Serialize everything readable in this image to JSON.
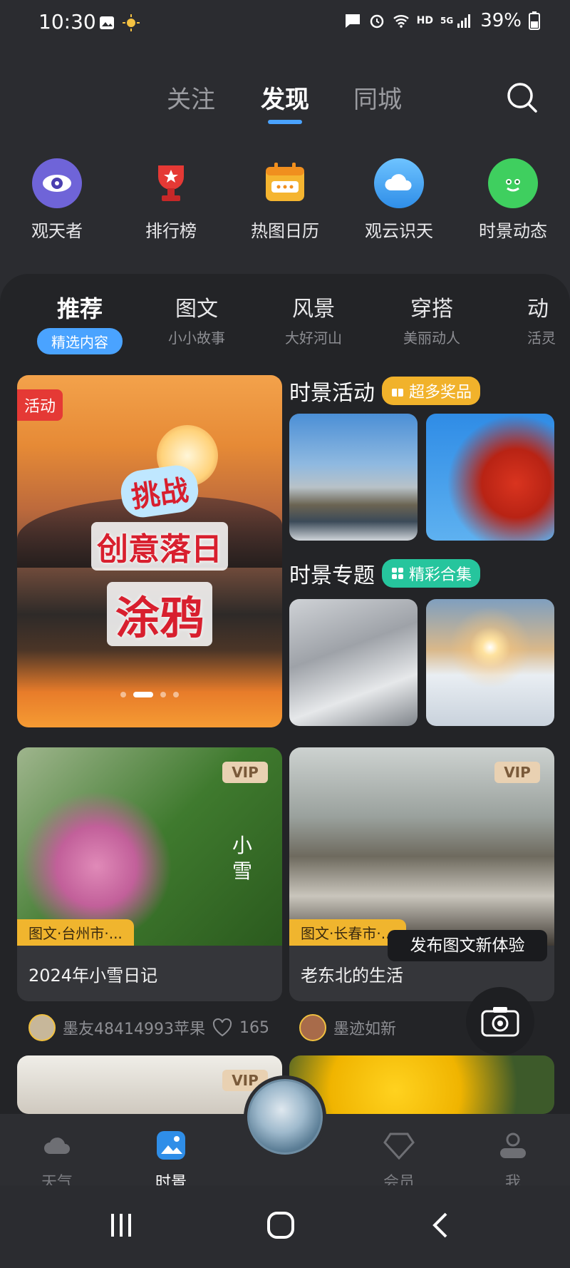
{
  "status_bar": {
    "time": "10:30",
    "network": "5G",
    "hd": "HD",
    "battery": "39%"
  },
  "top_tabs": [
    "关注",
    "发现",
    "同城"
  ],
  "top_tab_active": "发现",
  "quick_icons": [
    {
      "label": "观天者",
      "icon": "eye-icon",
      "color": "#6f64d8"
    },
    {
      "label": "排行榜",
      "icon": "trophy-icon",
      "color": "#e53935"
    },
    {
      "label": "热图日历",
      "icon": "calendar-icon",
      "color": "#f5b530"
    },
    {
      "label": "观云识天",
      "icon": "cloud-icon",
      "color": "#4aa3ff"
    },
    {
      "label": "时景动态",
      "icon": "planet-icon",
      "color": "#3fcf5f"
    }
  ],
  "categories": [
    {
      "title": "推荐",
      "sub": "精选内容"
    },
    {
      "title": "图文",
      "sub": "小小故事"
    },
    {
      "title": "风景",
      "sub": "大好河山"
    },
    {
      "title": "穿搭",
      "sub": "美丽动人"
    },
    {
      "title": "动",
      "sub": "活灵"
    }
  ],
  "banner": {
    "badge": "活动",
    "line1": "挑战",
    "line2": "创意落日",
    "line3": "涂鸦"
  },
  "activity_section": {
    "title": "时景活动",
    "pill": "超多奖品"
  },
  "topic_section": {
    "title": "时景专题",
    "pill": "精彩合集"
  },
  "feed": [
    {
      "vip": "VIP",
      "location": "图文·台州市·...",
      "title": "2024年小雪日记",
      "author": "墨友48414993苹果",
      "likes": "165",
      "overlay_text": "小雪"
    },
    {
      "vip": "VIP",
      "location": "图文·长春市·...",
      "title": "老东北的生活",
      "author": "墨迹如新"
    }
  ],
  "feed_row2": [
    {
      "vip": "VIP"
    }
  ],
  "tooltip": "发布图文新体验",
  "bottom_nav": [
    {
      "label": "天气"
    },
    {
      "label": "时景"
    },
    {
      "label": "会员"
    },
    {
      "label": "我"
    }
  ],
  "colors": {
    "accent": "#4aa3ff",
    "background": "#2b2c30",
    "vip_bg": "#e9d1b2",
    "location_bg": "#f0b52e"
  }
}
